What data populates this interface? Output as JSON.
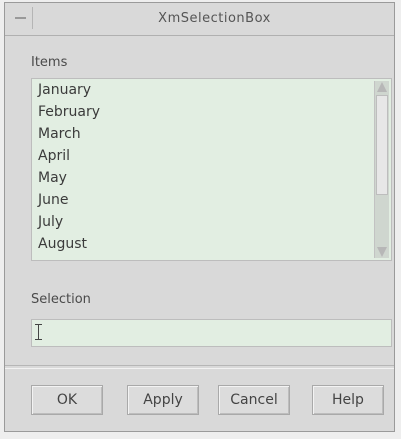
{
  "window": {
    "title": "XmSelectionBox"
  },
  "items_label": "Items",
  "items": [
    "January",
    "February",
    "March",
    "April",
    "May",
    "June",
    "July",
    "August"
  ],
  "selection_label": "Selection",
  "selection_value": "",
  "buttons": {
    "ok": "OK",
    "apply": "Apply",
    "cancel": "Cancel",
    "help": "Help"
  }
}
